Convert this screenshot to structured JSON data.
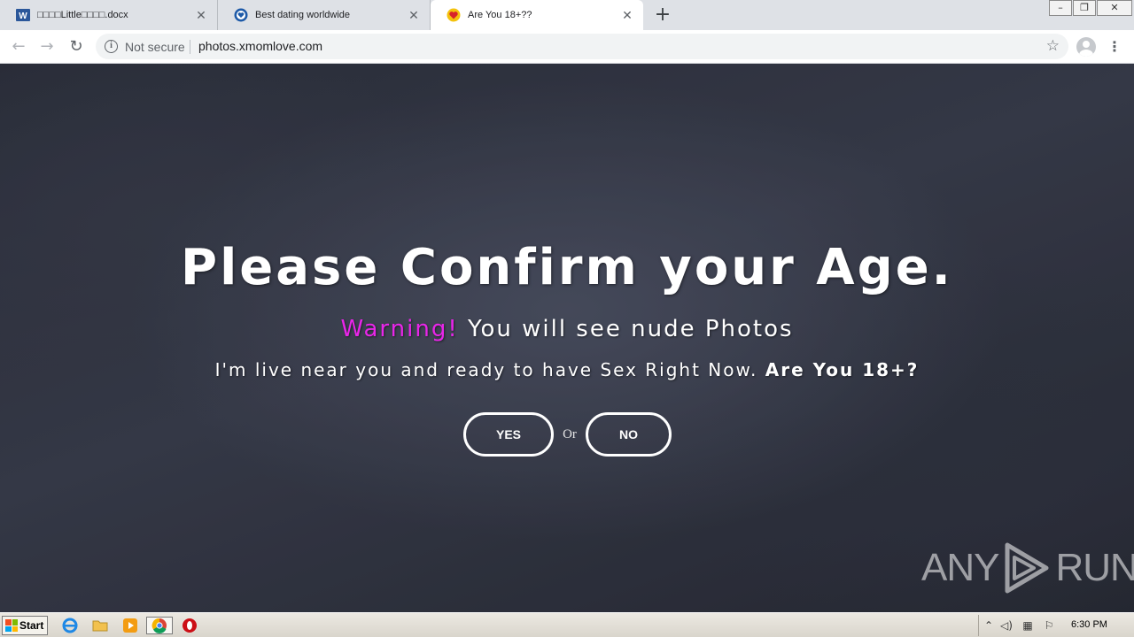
{
  "browser": {
    "tabs": [
      {
        "title": "□□□□Little□□□□.docx",
        "active": false,
        "icon": "word-icon"
      },
      {
        "title": "Best dating worldwide",
        "active": false,
        "icon": "shield-heart-icon"
      },
      {
        "title": "Are You 18+??",
        "active": true,
        "icon": "heart-icon"
      }
    ],
    "new_tab_label": "+",
    "window_controls": {
      "minimize": "–",
      "restore": "❐",
      "close": "✕"
    },
    "nav": {
      "back": "←",
      "forward": "→",
      "reload": "↻"
    },
    "address_bar": {
      "security_label": "Not secure",
      "url": "photos.xmomlove.com",
      "info_icon": "i",
      "star_icon": "☆"
    },
    "menu_icon": "⋮"
  },
  "page": {
    "headline": "Please Confirm your Age.",
    "warning_word": "Warning!",
    "warning_text": " You will see nude Photos",
    "subline_text": "I'm live near you and ready to have Sex Right Now. ",
    "subline_bold": "Are You 18+?",
    "yes_label": "YES",
    "or_label": "Or",
    "no_label": "NO",
    "accent_color": "#e826e8"
  },
  "watermark": {
    "left": "ANY",
    "right": "RUN"
  },
  "taskbar": {
    "start_label": "Start",
    "pinned": [
      "ie-icon",
      "explorer-folder-icon",
      "media-player-icon",
      "chrome-icon",
      "opera-icon"
    ],
    "clock": "6:30 PM"
  }
}
